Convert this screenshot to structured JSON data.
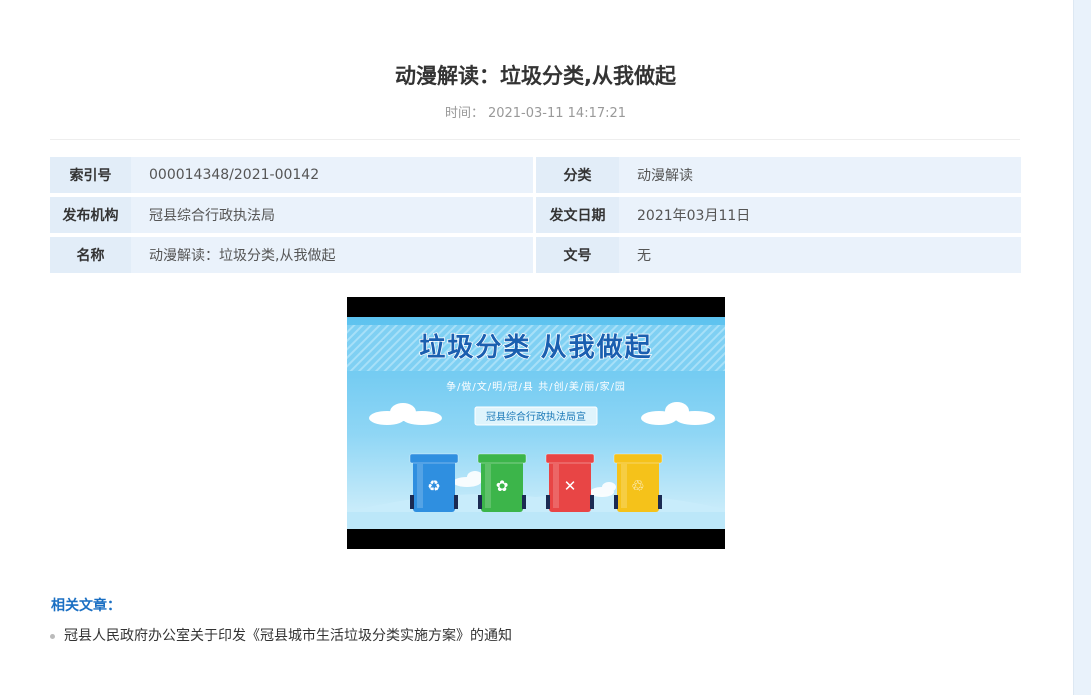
{
  "article": {
    "title": "动漫解读：垃圾分类,从我做起",
    "time_label": "时间：",
    "time_value": "2021-03-11 14:17:21"
  },
  "info": {
    "rows": [
      {
        "label1": "索引号",
        "value1": "000014348/2021-00142",
        "label2": "分类",
        "value2": "动漫解读"
      },
      {
        "label1": "发布机构",
        "value1": "冠县综合行政执法局",
        "label2": "发文日期",
        "value2": "2021年03月11日"
      },
      {
        "label1": "名称",
        "value1": "动漫解读：垃圾分类,从我做起",
        "label2": "文号",
        "value2": "无"
      }
    ]
  },
  "poster": {
    "headline": "垃圾分类 从我做起",
    "slogan": "争/做/文/明/冠/县  共/创/美/丽/家/园",
    "badge": "冠县综合行政执法局宣",
    "bins": [
      {
        "color": "#2f8fe0",
        "icon": "recycle-icon",
        "glyph": "♻"
      },
      {
        "color": "#3cb54a",
        "icon": "kitchen-waste-icon",
        "glyph": "✿"
      },
      {
        "color": "#e84545",
        "icon": "hazardous-waste-icon",
        "glyph": "✕"
      },
      {
        "color": "#f5c21a",
        "icon": "other-waste-icon",
        "glyph": "♲"
      }
    ]
  },
  "related": {
    "heading": "相关文章：",
    "items": [
      {
        "text": "冠县人民政府办公室关于印发《冠县城市生活垃圾分类实施方案》的通知"
      }
    ]
  },
  "colors": {
    "accent": "#1a6fc3",
    "label_bg": "#e2edf8",
    "value_bg": "#eaf2fb"
  }
}
